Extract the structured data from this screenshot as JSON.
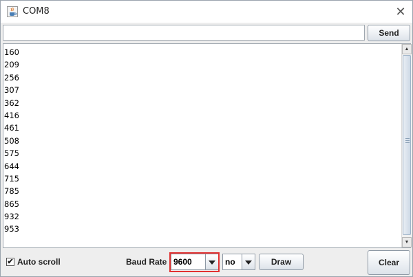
{
  "window": {
    "title": "COM8",
    "close_symbol": "✕",
    "icon": "java-cup-icon"
  },
  "send": {
    "input_value": "",
    "button_label": "Send"
  },
  "output": {
    "lines": [
      "160",
      "209",
      "256",
      "307",
      "362",
      "416",
      "461",
      "508",
      "575",
      "644",
      "715",
      "785",
      "865",
      "932",
      "953"
    ],
    "scrollbar": {
      "up_symbol": "▲",
      "down_symbol": "▼"
    }
  },
  "bottom": {
    "autoscroll_label": "Auto scroll",
    "autoscroll_checked": true,
    "autoscroll_check_symbol": "✔",
    "baud_label": "Baud Rate",
    "baud_value": "9600",
    "line_ending_value": "no",
    "draw_label": "Draw",
    "clear_label": "Clear"
  },
  "colors": {
    "highlight": "#e23131",
    "window_bg": "#eeeeee"
  }
}
